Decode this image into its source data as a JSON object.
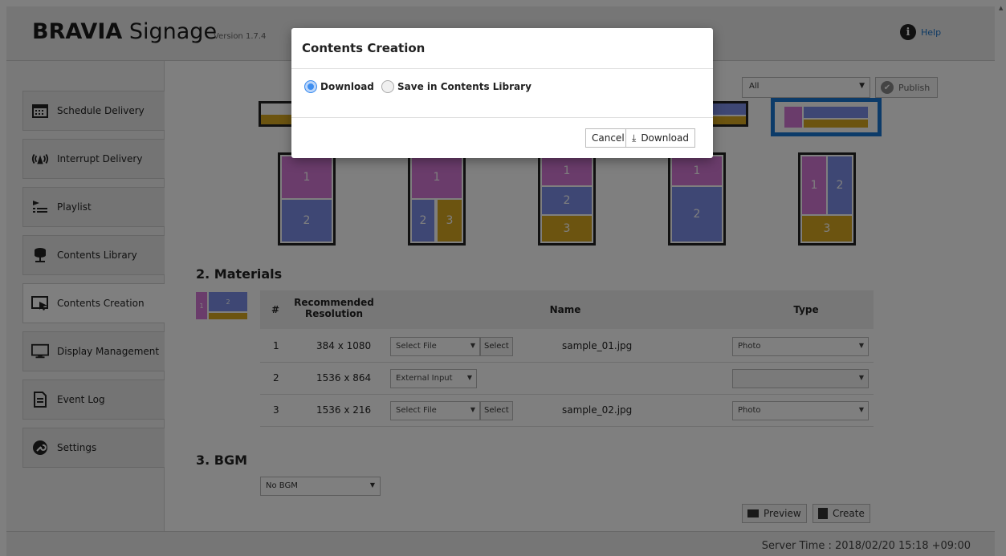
{
  "header": {
    "brand_bold": "BRAVIA",
    "brand_rest": " Signage",
    "version": "Version 1.7.4",
    "help_label": "Help"
  },
  "sidebar": {
    "items": [
      {
        "label": "Schedule Delivery",
        "icon": "calendar-icon"
      },
      {
        "label": "Interrupt Delivery",
        "icon": "broadcast-icon"
      },
      {
        "label": "Playlist",
        "icon": "playlist-icon"
      },
      {
        "label": "Contents Library",
        "icon": "library-icon"
      },
      {
        "label": "Contents Creation",
        "icon": "creation-icon"
      },
      {
        "label": "Display Management",
        "icon": "monitor-icon"
      },
      {
        "label": "Event Log",
        "icon": "document-icon"
      },
      {
        "label": "Settings",
        "icon": "wrench-icon"
      }
    ],
    "active_index": 4
  },
  "toolbar": {
    "filter_value": "All",
    "publish_label": "Publish"
  },
  "layouts": [
    {
      "zones": [
        "1",
        "2"
      ]
    },
    {
      "zones": [
        "1",
        "2",
        "3"
      ]
    },
    {
      "zones": [
        "1",
        "2",
        "3"
      ]
    },
    {
      "zones": [
        "1",
        "2"
      ]
    },
    {
      "zones": [
        "1",
        "2",
        "3"
      ]
    }
  ],
  "materials": {
    "title": "2. Materials",
    "thumb_labels": [
      "1",
      "2"
    ],
    "headers": {
      "num": "#",
      "resolution": "Recommended Resolution",
      "name": "Name",
      "type": "Type"
    },
    "rows": [
      {
        "num": "1",
        "resolution": "384 x 1080",
        "source": "Select File",
        "has_select": true,
        "select_label": "Select",
        "name": "sample_01.jpg",
        "type": "Photo"
      },
      {
        "num": "2",
        "resolution": "1536 x 864",
        "source": "External Input",
        "has_select": false,
        "select_label": "",
        "name": "",
        "type": ""
      },
      {
        "num": "3",
        "resolution": "1536 x 216",
        "source": "Select File",
        "has_select": true,
        "select_label": "Select",
        "name": "sample_02.jpg",
        "type": "Photo"
      }
    ]
  },
  "bgm": {
    "title": "3. BGM",
    "value": "No BGM"
  },
  "actions": {
    "preview_label": "Preview",
    "create_label": "Create"
  },
  "footer": {
    "server_time": "Server Time : 2018/02/20 15:18 +09:00"
  },
  "dialog": {
    "title": "Contents Creation",
    "options": [
      {
        "label": "Download",
        "selected": true
      },
      {
        "label": "Save in Contents Library",
        "selected": false
      }
    ],
    "cancel_label": "Cancel",
    "download_label": "Download"
  },
  "colors": {
    "zone_pink": "#d478d6",
    "zone_blue": "#7c8fe8",
    "zone_gold": "#d8a921",
    "radio_selected": "#3d8ef0",
    "help_link": "#1a73c8"
  }
}
